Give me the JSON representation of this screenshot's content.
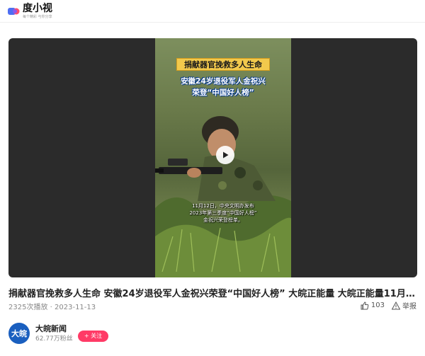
{
  "header": {
    "app_name": "度小视",
    "slogan": "每个精彩 与你分享"
  },
  "video": {
    "banner_line1": "捐献器官挽救多人生命",
    "banner_line2": "安徽24岁退役军人金祝兴",
    "banner_line3": "荣登“中国好人榜”",
    "caption_line1": "11月12日，中央文明办发布",
    "caption_line2": "2023年第三季度“中国好人榜”",
    "caption_line3": "金祝兴荣登榜单。"
  },
  "post": {
    "title": "捐献器官挽救多人生命 安徽24岁退役军人金祝兴荣登“中国好人榜” 大皖正能量 大皖正能量11月1...",
    "plays": "2325次播放",
    "separator": "·",
    "date": "2023-11-13",
    "like_count": "103",
    "report_label": "举报"
  },
  "author": {
    "avatar_text": "大皖",
    "name": "大皖新闻",
    "fans": "62.77万粉丝",
    "follow_label": "+ 关注"
  },
  "colors": {
    "brand_blue": "#4e6ef2",
    "follow_pink": "#ff3a66",
    "banner_yellow": "#f2c94c"
  }
}
